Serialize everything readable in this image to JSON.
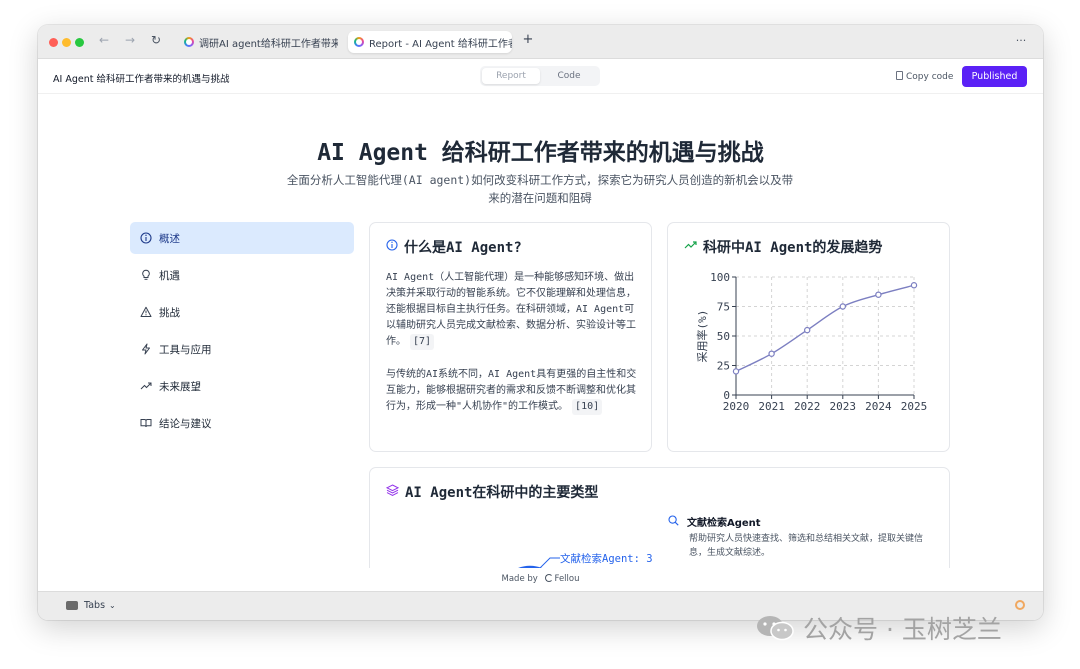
{
  "browser": {
    "tabs": [
      {
        "label": "调研AI agent给科研工作者带来的"
      },
      {
        "label": "Report - AI Agent 给科研工作者"
      }
    ],
    "new_tab": "+",
    "menu": "···",
    "back": "←",
    "forward": "→",
    "reload": "↻"
  },
  "appbar": {
    "title": "AI Agent 给科研工作者带来的机遇与挑战",
    "view_tabs": [
      "Report",
      "Code"
    ],
    "copy_label": "Copy code",
    "publish_label": "Published"
  },
  "report": {
    "title": "AI Agent 给科研工作者带来的机遇与挑战",
    "subtitle": "全面分析人工智能代理(AI agent)如何改变科研工作方式，探索它为研究人员创造的新机会以及带来的潜在问题和阻碍"
  },
  "sidenav": {
    "items": [
      {
        "label": "概述",
        "icon": "info-icon"
      },
      {
        "label": "机遇",
        "icon": "lightbulb-icon"
      },
      {
        "label": "挑战",
        "icon": "warning-icon"
      },
      {
        "label": "工具与应用",
        "icon": "bolt-icon"
      },
      {
        "label": "未来展望",
        "icon": "trend-icon"
      },
      {
        "label": "结论与建议",
        "icon": "book-icon"
      }
    ]
  },
  "what_card": {
    "title": "什么是AI Agent?",
    "p1": "AI Agent（人工智能代理）是一种能够感知环境、做出决策并采取行动的智能系统。它不仅能理解和处理信息，还能根据目标自主执行任务。在科研领域，AI Agent可以辅助研究人员完成文献检索、数据分析、实验设计等工作。",
    "cite1": "[7]",
    "p2": "与传统的AI系统不同，AI Agent具有更强的自主性和交互能力，能够根据研究者的需求和反馈不断调整和优化其行为，形成一种\"人机协作\"的工作模式。",
    "cite2": "[10]"
  },
  "trend_card": {
    "title": "科研中AI Agent的发展趋势"
  },
  "chart_data": {
    "type": "line",
    "x": [
      2020,
      2021,
      2022,
      2023,
      2024,
      2025
    ],
    "series": [
      {
        "values": [
          20,
          35,
          55,
          75,
          85,
          93
        ]
      }
    ],
    "ylabel": "采用率(%)",
    "xlabel": "",
    "ylim": [
      0,
      100
    ],
    "yticks": [
      0,
      25,
      50,
      75,
      100
    ],
    "grid": true,
    "line_color": "#7c7fc1"
  },
  "types_card": {
    "title": "AI Agent在科研中的主要类型",
    "pie_label": "文献检索Agent: 3",
    "item_title": "文献检索Agent",
    "item_desc": "帮助研究人员快速查找、筛选和总结相关文献，提取关键信息，生成文献综述。"
  },
  "footer": {
    "made_by": "Made by",
    "brand": "Fellou",
    "tabs_label": "Tabs"
  },
  "watermark": "公众号 · 玉树芝兰"
}
